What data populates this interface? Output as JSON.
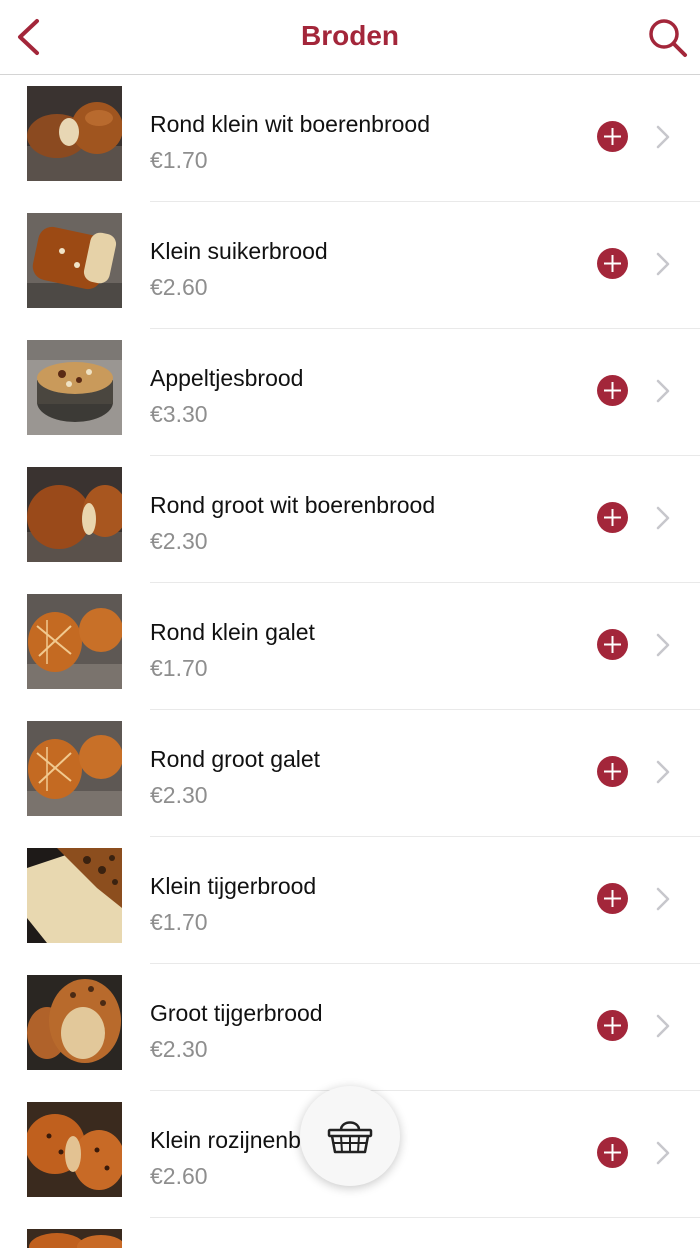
{
  "nav": {
    "title": "Broden",
    "back_icon": "chevron-left-icon",
    "search_icon": "search-icon",
    "accent_color": "#a3263a"
  },
  "products": [
    {
      "name": "Rond klein wit boerenbrood",
      "price": "€1.70"
    },
    {
      "name": "Klein suikerbrood",
      "price": "€2.60"
    },
    {
      "name": "Appeltjesbrood",
      "price": "€3.30"
    },
    {
      "name": "Rond groot wit boerenbrood",
      "price": "€2.30"
    },
    {
      "name": "Rond klein galet",
      "price": "€1.70"
    },
    {
      "name": "Rond groot galet",
      "price": "€2.30"
    },
    {
      "name": "Klein tijgerbrood",
      "price": "€1.70"
    },
    {
      "name": "Groot tijgerbrood",
      "price": "€2.30"
    },
    {
      "name": "Klein rozijnenbrood",
      "price": "€2.60"
    }
  ],
  "basket": {
    "icon": "basket-icon"
  },
  "colors": {
    "price": "#8e8e8e",
    "add_button": "#a3263a",
    "chevron": "#c7c7cc"
  }
}
